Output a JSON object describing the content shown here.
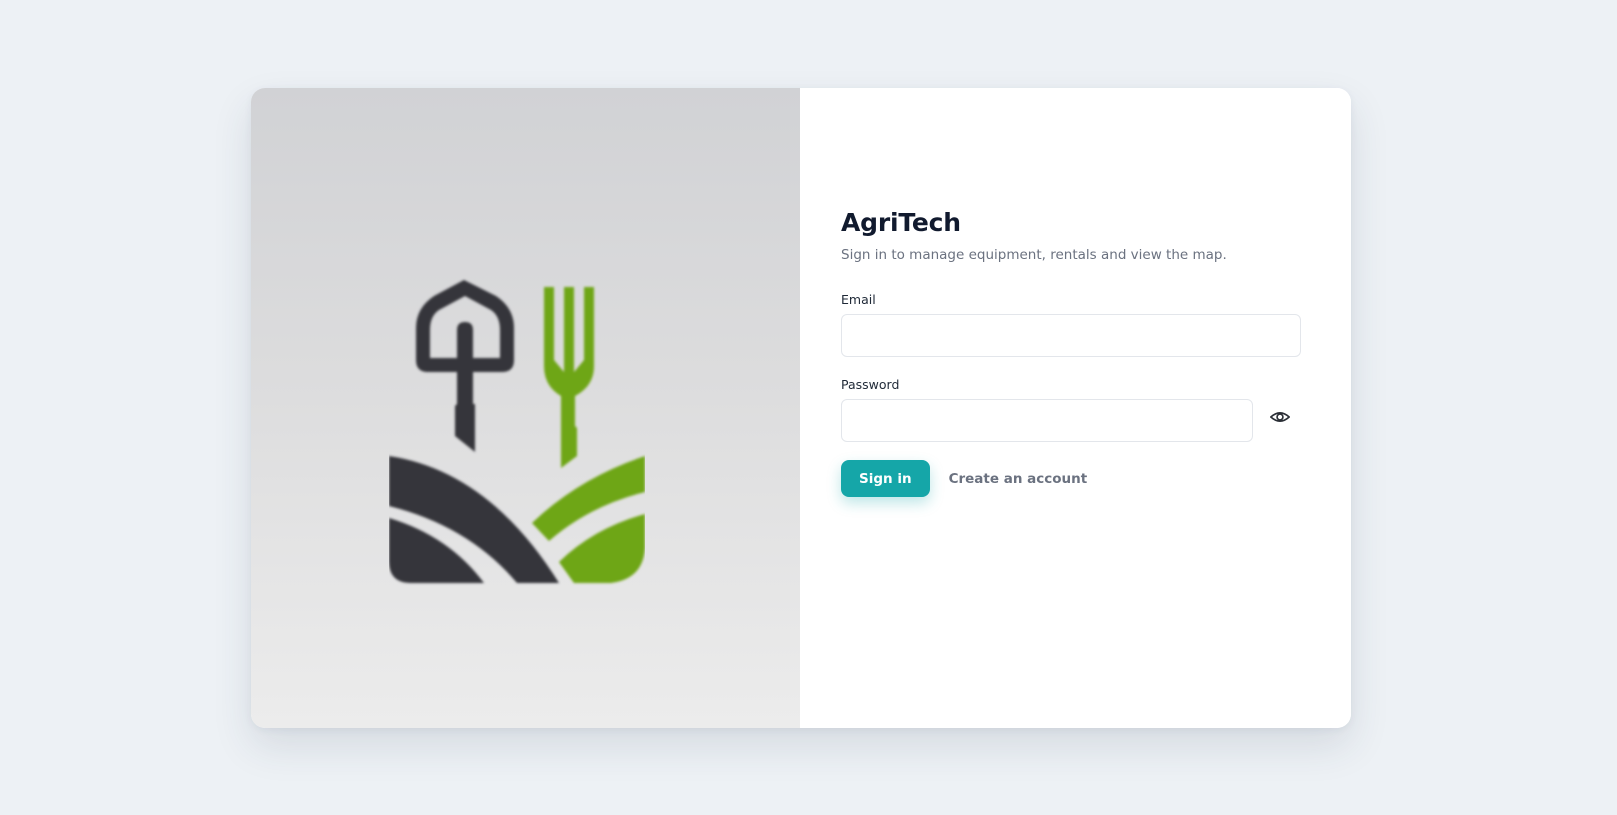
{
  "brand": {
    "title": "AgriTech",
    "subtitle": "Sign in to manage equipment, rentals and view the map.",
    "logo_icon": "agritech-logo-icon",
    "logo_colors": {
      "dark": "#35353a",
      "green": "#6ea614"
    }
  },
  "form": {
    "email_label": "Email",
    "email_value": "",
    "email_placeholder": "",
    "password_label": "Password",
    "password_value": "",
    "password_placeholder": "",
    "toggle_icon": "eye-icon",
    "signin_label": "Sign in",
    "create_account_label": "Create an account"
  },
  "colors": {
    "accent": "#15a6a8",
    "background": "#edf1f5",
    "title": "#111a2e",
    "muted": "#6b7280"
  }
}
